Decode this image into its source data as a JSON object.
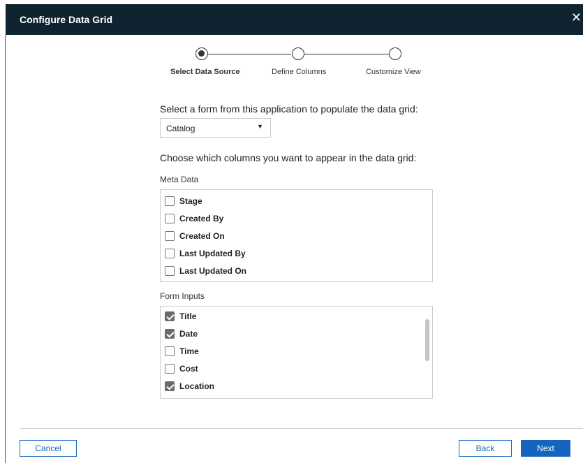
{
  "dialog": {
    "title": "Configure Data Grid",
    "close_glyph": "✕"
  },
  "stepper": {
    "steps": [
      {
        "label": "Select Data Source",
        "active": true
      },
      {
        "label": "Define Columns",
        "active": false
      },
      {
        "label": "Customize View",
        "active": false
      }
    ]
  },
  "form": {
    "select_prompt": "Select a form from this application to populate the data grid:",
    "selected_form": "Catalog",
    "columns_prompt": "Choose which columns you want to appear in the data grid:"
  },
  "meta_data": {
    "label": "Meta Data",
    "items": [
      {
        "label": "Stage",
        "checked": false
      },
      {
        "label": "Created By",
        "checked": false
      },
      {
        "label": "Created On",
        "checked": false
      },
      {
        "label": "Last Updated By",
        "checked": false
      },
      {
        "label": "Last Updated On",
        "checked": false
      }
    ]
  },
  "form_inputs": {
    "label": "Form Inputs",
    "items": [
      {
        "label": "Title",
        "checked": true
      },
      {
        "label": "Date",
        "checked": true
      },
      {
        "label": "Time",
        "checked": false
      },
      {
        "label": "Cost",
        "checked": false
      },
      {
        "label": "Location",
        "checked": true
      }
    ]
  },
  "footer": {
    "cancel_label": "Cancel",
    "back_label": "Back",
    "next_label": "Next"
  },
  "colors": {
    "titlebar": "#0f2430",
    "accent": "#1565c0"
  }
}
